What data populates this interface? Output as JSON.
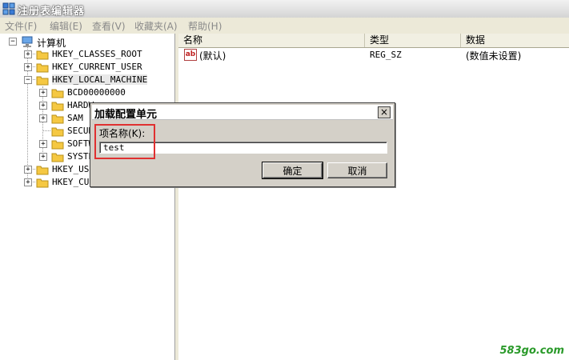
{
  "window": {
    "title": "注册表编辑器"
  },
  "menu": [
    "文件(F)",
    "编辑(E)",
    "查看(V)",
    "收藏夹(A)",
    "帮助(H)"
  ],
  "tree": {
    "root": "计算机",
    "hives": [
      "HKEY_CLASSES_ROOT",
      "HKEY_CURRENT_USER",
      "HKEY_LOCAL_MACHINE",
      "HKEY_USE",
      "HKEY_CUR"
    ],
    "hklm_children": [
      "BCD00000000",
      "HARDW",
      "SAM",
      "SECUR",
      "SOFTW",
      "SYSTE"
    ]
  },
  "list": {
    "columns": [
      "名称",
      "类型",
      "数据"
    ],
    "rows": [
      {
        "name": "(默认)",
        "type": "REG_SZ",
        "data": "(数值未设置)"
      }
    ]
  },
  "dialog": {
    "title": "加载配置单元",
    "label": "项名称(K):",
    "value": "test",
    "ok": "确定",
    "cancel": "取消",
    "close": "×"
  },
  "watermark": "583go.com",
  "colors": {
    "highlight": "#e03030",
    "folder": "#f5c842",
    "watermark": "#2a9a2a"
  }
}
